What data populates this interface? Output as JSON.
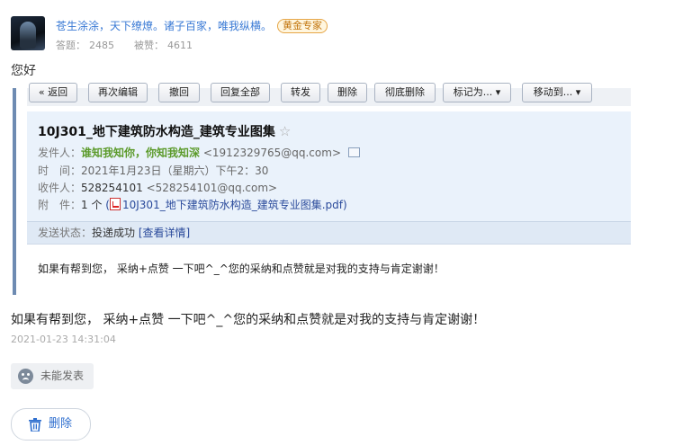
{
  "user": {
    "motto": "苍生涂涂，天下缭燎。诸子百家，唯我纵横。",
    "badge": "黄金专家",
    "answers_label": "答题：",
    "answers_value": "2485",
    "likes_label": "被赞：",
    "likes_value": "4611",
    "avatar": "avatar"
  },
  "greeting": "您好",
  "mail_toolbar": {
    "back": "« 返回",
    "edit_again": "再次编辑",
    "recall": "撤回",
    "reply_all": "回复全部",
    "forward": "转发",
    "delete": "删除",
    "delete_forever": "彻底删除",
    "mark_as": "标记为...",
    "move_to": "移动到..."
  },
  "mail": {
    "subject": "10J301_地下建筑防水构造_建筑专业图集",
    "star": "☆",
    "from_label": "发件人：",
    "from_name": "谁知我知你，你知我知深",
    "from_email": "<1912329765@qq.com>",
    "time_label": "时　间：",
    "time_value": "2021年1月23日（星期六）下午2：30",
    "to_label": "收件人：",
    "to_name": "528254101",
    "to_email": "<528254101@qq.com>",
    "attach_label": "附　件：",
    "attach_count": "1 个",
    "attach_file": "10J301_地下建筑防水构造_建筑专业图集.pdf",
    "status_label": "发送状态：",
    "status_value": "投递成功",
    "status_link": "[查看详情]",
    "body": "如果有帮到您， 采纳+点赞 一下吧^_^您的采纳和点赞就是对我的支持与肯定谢谢！"
  },
  "reply_text": "如果有帮到您， 采纳+点赞 一下吧^_^您的采纳和点赞就是对我的支持与肯定谢谢！",
  "timestamp": "2021-01-23 14:31:04",
  "unpublished_label": "未能发表",
  "delete_label": "删除",
  "colors": {
    "link_blue": "#3a7ad5",
    "accent_blue": "#2f6fcf",
    "badge_orange": "#c2740c",
    "mail_header_bg": "#eaf2fb",
    "sender_green": "#5b9a2a"
  }
}
